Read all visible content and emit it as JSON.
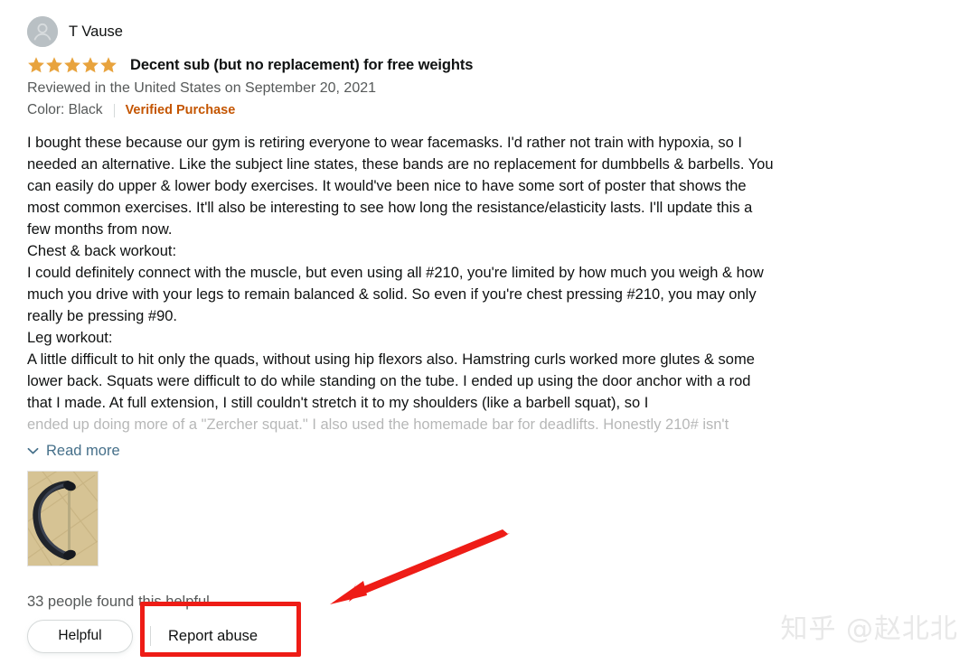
{
  "review": {
    "reviewer_name": "T Vause",
    "avatar_icon": "person-avatar-icon",
    "rating_stars": 5,
    "rating_icon": "star-filled-icon",
    "title": "Decent sub (but no replacement) for free weights",
    "date_line": "Reviewed in the United States on September 20, 2021",
    "color_line": "Color: Black",
    "verified_badge": "Verified Purchase",
    "body_paragraphs": [
      "I bought these because our gym is retiring everyone to wear facemasks. I'd rather not train with hypoxia, so I needed an alternative. Like the subject line states, these bands are no replacement for dumbbells & barbells. You can easily do upper & lower body exercises. It would've been nice to have some sort of poster that shows the most common exercises. It'll also be interesting to see how long the resistance/elasticity lasts. I'll update this a few months from now.",
      "Chest & back workout:",
      "I could definitely connect with the muscle, but even using all #210, you're limited by how much you weigh & how much you drive with your legs to remain balanced & solid. So even if you're chest pressing #210, you may only really be pressing #90.",
      "Leg workout:",
      "A little difficult to hit only the quads, without using hip flexors also. Hamstring curls worked more glutes & some lower back. Squats were difficult to do while standing on the tube. I ended up using the door anchor with a rod that I made. At full extension, I still couldn't stretch it to my shoulders (like a barbell squat), so I"
    ],
    "body_truncated_line": "ended up doing more of a \"Zercher squat.\" I also used the homemade bar for deadlifts. Honestly 210# isn't",
    "read_more_label": "Read more",
    "read_more_icon": "chevron-down-icon",
    "image_thumbnail_alt": "review-photo-resistance-band",
    "helpful_count_text": "33 people found this helpful",
    "helpful_button_label": "Helpful",
    "report_abuse_label": "Report abuse"
  },
  "annotations": {
    "box_color": "#ee1c16",
    "arrow_color": "#ee1c16",
    "arrow_name": "red-pointer-arrow",
    "box_target": "report-abuse-button"
  },
  "watermark": {
    "text": "知乎 @赵北北"
  },
  "colors": {
    "star": "#e8a33d",
    "verified": "#c45500",
    "link": "#46708a",
    "muted_text": "#565959",
    "primary_text": "#0f1111",
    "accent_red": "#ee1c16"
  }
}
